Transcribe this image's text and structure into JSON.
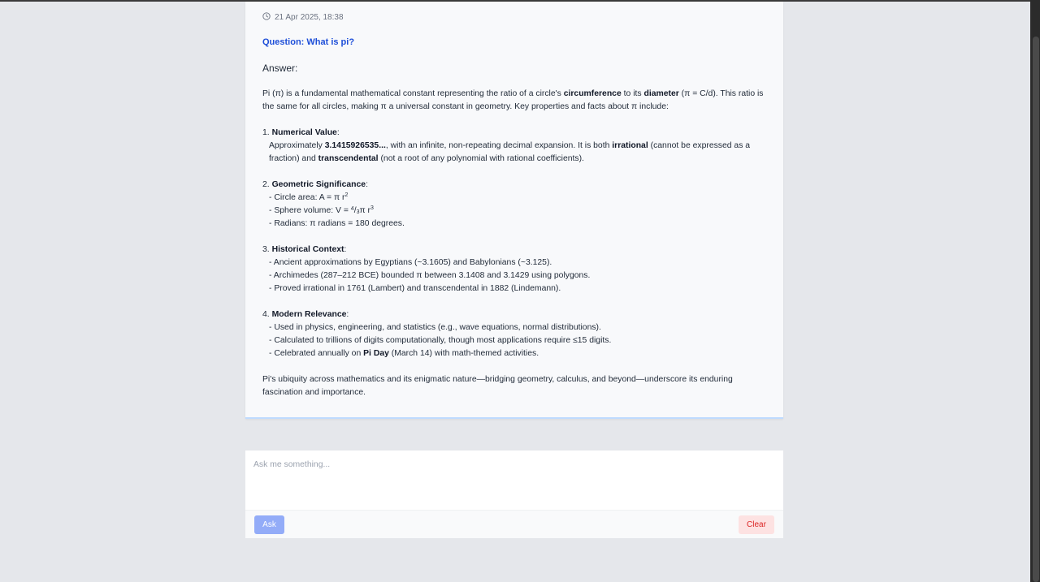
{
  "message": {
    "timestamp": "21 Apr 2025, 18:38",
    "question": "Question: What is pi?",
    "answer_label": "Answer:",
    "intro": {
      "p1": "Pi (π) is a fundamental mathematical constant representing the ratio of a circle's ",
      "b1": "circumference",
      "p2": " to its ",
      "b2": "diameter",
      "p3": " (π = C/d). This ratio is the same for all circles, making π a universal constant in geometry. Key properties and facts about π include:"
    },
    "s1": {
      "num": "1. ",
      "title": "Numerical Value",
      "colon": ":",
      "l1a": "Approximately ",
      "l1b": "3.1415926535...",
      "l1c": ", with an infinite, non-repeating decimal expansion. It is both ",
      "l1d": "irrational",
      "l1e": " (cannot be expressed as a fraction) and ",
      "l1f": "transcendental",
      "l1g": " (not a root of any polynomial with rational coefficients)."
    },
    "s2": {
      "num": "2. ",
      "title": "Geometric Significance",
      "colon": ":",
      "circle_a": "- Circle area:  A = π r",
      "circle_sup": "2",
      "sphere_a": "- Sphere volume:  V = ",
      "sphere_num": "4",
      "sphere_slash": "/",
      "sphere_den": "3",
      "sphere_b": "π r",
      "sphere_sup": "3",
      "radians": "- Radians:  π  radians = 180 degrees."
    },
    "s3": {
      "num": "3. ",
      "title": "Historical Context",
      "colon": ":",
      "items": [
        "- Ancient approximations by Egyptians (~3.1605) and Babylonians (~3.125).",
        "- Archimedes (287–212 BCE) bounded π between 3.1408 and 3.1429 using polygons.",
        "- Proved irrational in 1761 (Lambert) and transcendental in 1882 (Lindemann)."
      ]
    },
    "s4": {
      "num": "4. ",
      "title": "Modern Relevance",
      "colon": ":",
      "i1": "- Used in physics, engineering, and statistics (e.g., wave equations, normal distributions).",
      "i2": "- Calculated to trillions of digits computationally, though most applications require ≤15 digits.",
      "i3a": "- Celebrated annually on ",
      "i3b": "Pi Day",
      "i3c": " (March 14) with math-themed activities."
    },
    "outro": "Pi's ubiquity across mathematics and its enigmatic nature—bridging geometry, calculus, and beyond—underscore its enduring fascination and importance."
  },
  "composer": {
    "placeholder": "Ask me something...",
    "ask_label": "Ask",
    "clear_label": "Clear"
  },
  "colors": {
    "question": "#1d4ed8",
    "ask_button": "#93acf8",
    "clear_button_bg": "#fde2e2",
    "clear_button_text": "#dc2626"
  },
  "icons": {
    "timestamp": "clock-icon"
  }
}
